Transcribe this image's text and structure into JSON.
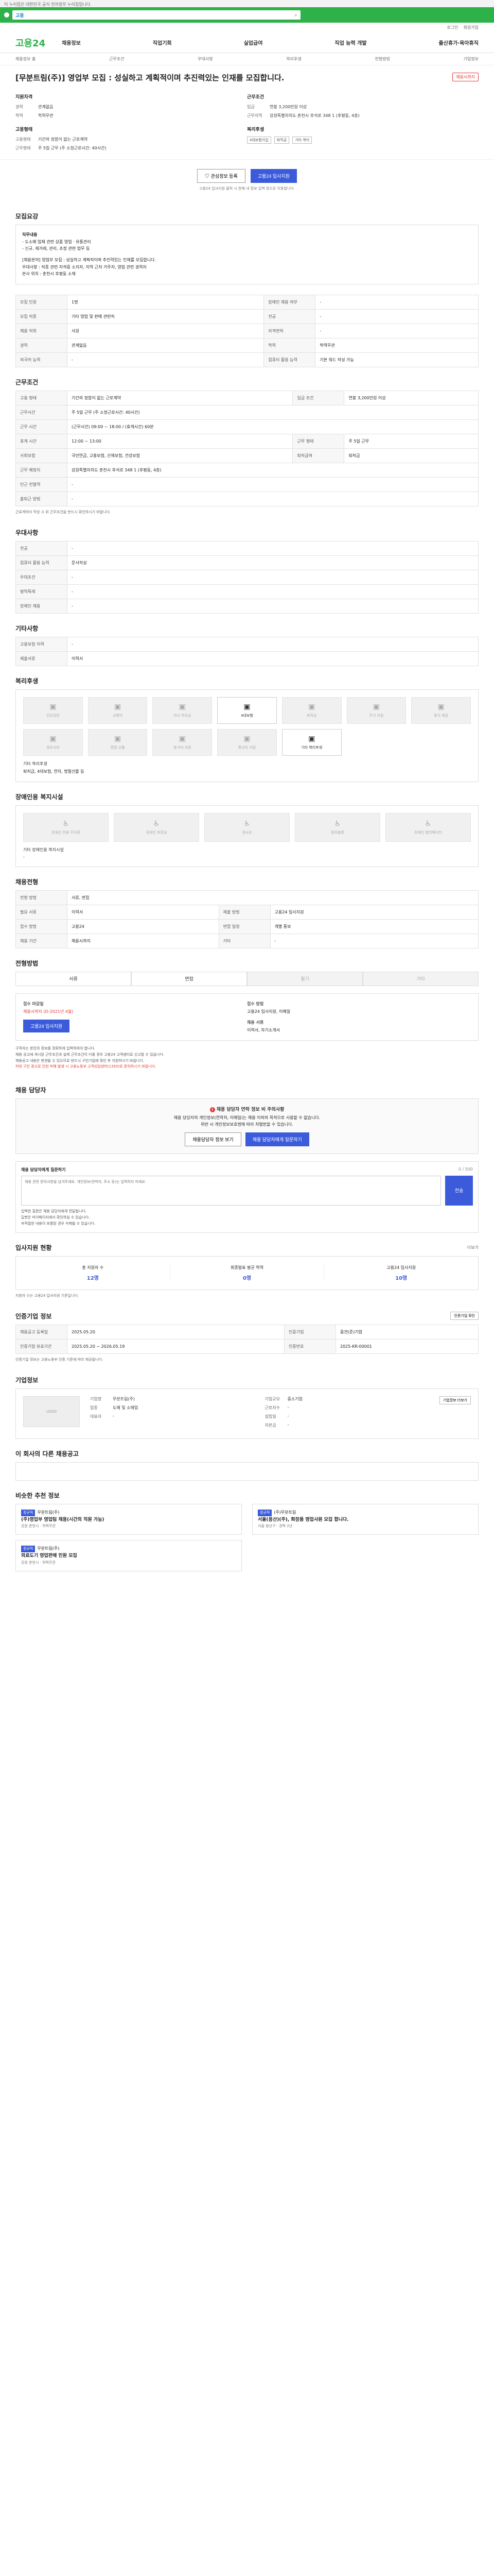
{
  "topbar": {
    "text": "이 누리집은 대한민국 공식 전자정부 누리집입니다."
  },
  "search": {
    "gov_label": "고용",
    "placeholder": ""
  },
  "util": [
    "로그인",
    "회원가입"
  ],
  "brand": {
    "name": "고용24"
  },
  "gnb": [
    "채용정보",
    "직업기회",
    "실업급여",
    "직업 능력 개발",
    "출산휴가·육아휴직"
  ],
  "subnav": [
    "채용정보 홈",
    "근무조건",
    "우대사항",
    "복리후생",
    "전형방법",
    "기업정보"
  ],
  "job": {
    "title": "[무분트림(주)] 영업부 모집 : 성실하고 계획적이며 추진력있는 인재를 모집합니다.",
    "badge": "채용시까지"
  },
  "company": {
    "head1": "지원자격",
    "head2": "근무조건",
    "rows1": [
      {
        "k": "경력",
        "v": "관계없음"
      },
      {
        "k": "학력",
        "v": "학력무관"
      }
    ],
    "rows2": [
      {
        "k": "임금",
        "v": "연봉 3,200만원 이상"
      },
      {
        "k": "근무지역",
        "v": "강원특별자치도 춘천시 후석로 348 1 (후평동, 4층)"
      }
    ],
    "head3": "고용형태",
    "head4": "복리후생",
    "rows3": [
      {
        "k": "고용형태",
        "v": "기간의 정함이 없는 근로계약"
      },
      {
        "k": "근무형태",
        "v": "주 5일 근무 (주 소정근로시간: 40시간)"
      }
    ],
    "tags": [
      "4대보험가입",
      "퇴직금",
      "기타 복리"
    ]
  },
  "buttons": {
    "interest": "관심정보 등록",
    "apply": "고용24 입사지원"
  },
  "apply_notice": "고용24 입사지원 클릭 시 현재 내 정보 입력 창으로 이동합니다.",
  "recruit": {
    "title": "모집요강",
    "lines": [
      "직무내용",
      "- 도소매 업체 관련 상품 영업 · 유통관리",
      "- 신규, 재거래, 관리, 조정 관련 업무 등",
      "[채용분야] 영업부 모집 : 성실하고 계획적이며 추진력있는 인재를 모집합니다.",
      "우대사항 : 직종 관련 자격증 소지자, 지역 근처 거주자, 영업 관련 경력자",
      "본사 위치 : 춘천시 후평동 소재"
    ]
  },
  "req_table": [
    {
      "k1": "모집 인원",
      "v1": "1명",
      "k2": "장애인 채용 여부",
      "v2": "-"
    },
    {
      "k1": "모집 직종",
      "v1": "기타 영업 및 판매 관련직",
      "k2": "전공",
      "v2": "-"
    },
    {
      "k1": "채용 직위",
      "v1": "사원",
      "k2": "자격면허",
      "v2": "-"
    },
    {
      "k1": "경력",
      "v1": "관계없음",
      "k2": "학력",
      "v2": "학력무관"
    },
    {
      "k1": "외국어 능력",
      "v1": "-",
      "k2": "컴퓨터 활용 능력",
      "v2": "기본 워드 작성 가능"
    }
  ],
  "cond": {
    "title": "근무조건",
    "rows": [
      {
        "k1": "고용 형태",
        "v1": "기간의 정함이 없는 근로계약",
        "k2": "임금 조건",
        "v2": "연봉 3,200만원 이상"
      },
      {
        "k1": "근무시간",
        "v1": "주 5일 근무 (주 소정근로시간: 40시간)",
        "k2": "",
        "v2": ""
      },
      {
        "k1": "근무 시간",
        "v1": "(근무시간) 09:00 ~ 18:00 / (휴게시간) 60분",
        "k2": "",
        "v2": ""
      },
      {
        "k1": "휴게 시간",
        "v1": "12:00 ~ 13:00",
        "k2": "근무 형태",
        "v2": "주 5일 근무"
      },
      {
        "k1": "사회보험",
        "v1": "국민연금, 고용보험, 산재보험, 건강보험",
        "k2": "퇴직급여",
        "v2": "퇴직금"
      },
      {
        "k1": "근무 예정지",
        "v1": "강원특별자치도 춘천시 후석로 348 1 (후평동, 4층)",
        "k2": "",
        "v2": ""
      },
      {
        "k1": "인근 전철역",
        "v1": "-",
        "k2": "",
        "v2": ""
      },
      {
        "k1": "출퇴근 방법",
        "v1": "-",
        "k2": "",
        "v2": ""
      }
    ],
    "note": "근로계약서 작성 시 위 근무조건을 반드시 확인하시기 바랍니다."
  },
  "pref": {
    "title": "우대사항",
    "rows": [
      {
        "k": "전공",
        "v": "-"
      },
      {
        "k": "컴퓨터 활용 능력",
        "v": "문서작성"
      },
      {
        "k": "우대조건",
        "v": "-"
      },
      {
        "k": "병역특례",
        "v": "-"
      },
      {
        "k": "장애인 채용",
        "v": "-"
      }
    ]
  },
  "other": {
    "title": "기타사항",
    "rows": [
      {
        "k": "고용보험 이력",
        "v": "-"
      },
      {
        "k": "제출서류",
        "v": "이력서"
      }
    ]
  },
  "welfare": {
    "title": "복리후생",
    "items": [
      {
        "name": "건강검진",
        "on": false
      },
      {
        "name": "교통비",
        "on": false
      },
      {
        "name": "자녀 학자금",
        "on": false
      },
      {
        "name": "4대보험",
        "on": true
      },
      {
        "name": "퇴직금",
        "on": false
      },
      {
        "name": "주거 지원",
        "on": false
      },
      {
        "name": "중식 제공",
        "on": false
      },
      {
        "name": "경조사비",
        "on": false
      },
      {
        "name": "명절 선물",
        "on": false
      },
      {
        "name": "휴가비 지원",
        "on": false
      },
      {
        "name": "통신비 지원",
        "on": false
      },
      {
        "name": "기타 복리후생",
        "on": true
      }
    ],
    "other_label": "기타 복리후생",
    "other_text": "퇴직금, 4대보험, 연차, 명절선물 등"
  },
  "disab": {
    "title": "장애인용 복지시설",
    "items": [
      "장애인 전용 주차장",
      "장애인 화장실",
      "경사로",
      "점자블록",
      "장애인 엘리베이터"
    ],
    "label": "기타 장애인용 복지시설",
    "value": "-"
  },
  "hire": {
    "title": "채용전형",
    "rows": [
      {
        "k1": "전형 방법",
        "v1": "서류, 면접",
        "k2": "",
        "v2": ""
      },
      {
        "k1": "필요 서류",
        "v1": "이력서",
        "k2": "제출 방법",
        "v2": "고용24 입사지원"
      },
      {
        "k1": "접수 방법",
        "v1": "고용24",
        "k2": "면접 일정",
        "v2": "개별 통보"
      },
      {
        "k1": "채용 기간",
        "v1": "채용시까지",
        "k2": "기타",
        "v2": "-"
      }
    ]
  },
  "process": {
    "title": "전형방법",
    "steps": [
      {
        "n": "서류",
        "on": true
      },
      {
        "n": "면접",
        "on": true
      },
      {
        "n": "필기",
        "on": false
      },
      {
        "n": "기타",
        "on": false
      }
    ]
  },
  "applyinfo": {
    "lb1": "접수 마감일",
    "vl1": "채용시까지 (D-2021년 4월)",
    "lb2": "접수 방법",
    "vl2": "고용24 입사지원, 이메일",
    "lb3": "채용 서류",
    "vl3": "이력서, 자기소개서",
    "btn": "고용24 입사지원"
  },
  "notes": [
    "구직자는 본인의 정보를 정확하게 입력하여야 합니다.",
    "채용 공고에 게시된 근무조건과 실제 근무조건이 다를 경우 고용24 고객센터로 신고할 수 있습니다.",
    "채용공고 내용은 변경될 수 있으므로 반드시 구인기업에 확인 후 지원하시기 바랍니다.",
    "허위 구인 광고로 인한 피해 발생 시 고용노동부 고객상담센터(1350)로 문의하시기 바랍니다."
  ],
  "warn": {
    "section": "채용 담당자",
    "title": "채용 담당자 연락 정보 비 주의사항",
    "lines": [
      "채용 담당자의 개인정보(연락처, 이메일)는 채용 이외의 목적으로 사용할 수 없습니다.",
      "위반 시 개인정보보호법에 따라 처벌받을 수 있습니다."
    ],
    "btn1": "채용담당자 정보 보기",
    "btn2": "채용 담당자에게 질문하기"
  },
  "qa": {
    "title": "채용 담당자에게 질문하기",
    "counter": "0 / 500",
    "placeholder": "채용 관련 문의사항을 남겨주세요. 개인정보(연락처, 주소 등)는 입력하지 마세요.",
    "send": "전송",
    "notes": [
      "입력한 질문은 채용 담당자에게 전달됩니다.",
      "답변은 마이페이지에서 확인하실 수 있습니다.",
      "부적절한 내용이 포함된 경우 삭제될 수 있습니다."
    ]
  },
  "stats": {
    "title": "입사지원 현황",
    "more": "더보기",
    "items": [
      {
        "label": "총 지원자 수",
        "value": "12명"
      },
      {
        "label": "최종발표 평균 학력",
        "value": "0명"
      },
      {
        "label": "고용24 입사지원",
        "value": "10명"
      }
    ],
    "note": "지원자 수는 고용24 입사지원 기준입니다."
  },
  "regist": {
    "title": "인증기업 정보",
    "btn": "인증기업 확인",
    "rows": [
      {
        "k1": "채용공고 등록일",
        "v1": "2025.05.20",
        "k2": "인증기업",
        "v2": "중견(준)기업"
      },
      {
        "k1": "인증기업 유효기간",
        "v1": "2025.05.20 ~ 2026.05.19",
        "k2": "인증번호",
        "v2": "2025-KR-00001"
      }
    ],
    "note": "인증기업 정보는 고용노동부 인증 기준에 따라 제공됩니다."
  },
  "corp": {
    "title": "기업정보",
    "logo": "LOGO",
    "btn": "기업정보 더보기",
    "left": [
      {
        "k": "기업명",
        "v": "무분트림(주)"
      },
      {
        "k": "업종",
        "v": "도매 및 소매업"
      },
      {
        "k": "대표자",
        "v": "-"
      }
    ],
    "right": [
      {
        "k": "기업규모",
        "v": "중소기업"
      },
      {
        "k": "근로자수",
        "v": "-"
      },
      {
        "k": "설립일",
        "v": "-"
      },
      {
        "k": "자본금",
        "v": "-"
      }
    ]
  },
  "similar": {
    "title": "이 회사의 다른 채용공고"
  },
  "more_jobs": {
    "title": "비슷한 추천 정보",
    "cards": [
      {
        "badge": "정규직",
        "company": "무분트림(주)",
        "title": "(주)영업부 영업팀 채용(시간의 직원 가능)",
        "meta": "강원 춘천시 · 학력무관"
      },
      {
        "badge": "정규직",
        "company": "(주)무분트림",
        "title": "서울(용산)(주), 화장품 영업사원 모집 합니다.",
        "meta": "서울 용산구 · 경력 2년"
      },
      {
        "badge": "정규직",
        "company": "무분트림(주)",
        "title": "외료도기 영업판매 인원 모집",
        "meta": "강원 춘천시 · 학력무관"
      }
    ]
  }
}
